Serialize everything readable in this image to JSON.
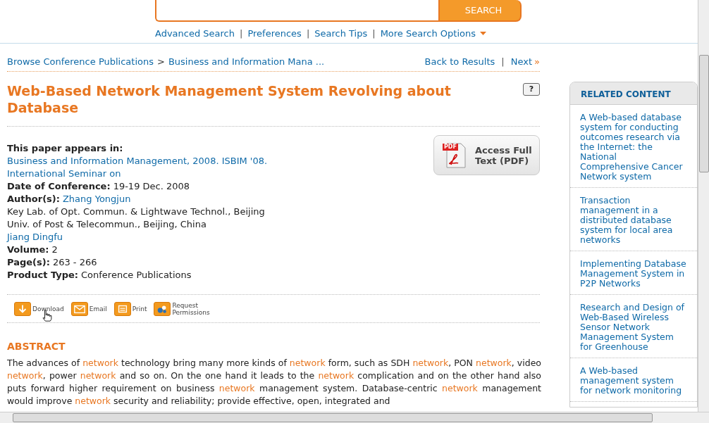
{
  "search": {
    "button": "SEARCH",
    "separator": "|",
    "links": [
      "Advanced Search",
      "Preferences",
      "Search Tips",
      "More Search Options"
    ]
  },
  "breadcrumb": {
    "items": [
      "Browse Conference Publications",
      "Business and Information Mana ..."
    ],
    "separator": ">"
  },
  "result_nav": {
    "back": "Back to Results",
    "next": "Next",
    "next_mark": "»",
    "separator": "|"
  },
  "title": "Web-Based Network Management System Revolving about Database",
  "help_button": "?",
  "pdf_button": {
    "badge": "PDF",
    "label": "Access Full Text (PDF)"
  },
  "metadata": [
    {
      "kind": "heading",
      "label": "This paper appears in:"
    },
    {
      "kind": "link",
      "text": "Business and Information Management, 2008. ISBIM '08. International Seminar on"
    },
    {
      "kind": "field",
      "label": "Date of Conference:",
      "value": "19-19 Dec. 2008"
    },
    {
      "kind": "field_link",
      "label": "Author(s):",
      "value": "Zhang Yongjun"
    },
    {
      "kind": "plain",
      "text": "Key Lab. of Opt. Commun. & Lightwave Technol., Beijing"
    },
    {
      "kind": "plain",
      "text": "Univ. of Post & Telecommun., Beijing, China"
    },
    {
      "kind": "link",
      "text": "Jiang Dingfu"
    },
    {
      "kind": "field",
      "label": "Volume:",
      "value": "2"
    },
    {
      "kind": "field",
      "label": "Page(s):",
      "value": "263 - 266"
    },
    {
      "kind": "field",
      "label": "Product Type:",
      "value": "Conference Publications"
    }
  ],
  "actions": [
    {
      "kind": "download",
      "lines": [
        "Download"
      ]
    },
    {
      "kind": "email",
      "lines": [
        "Email"
      ]
    },
    {
      "kind": "print",
      "lines": [
        "Print"
      ]
    },
    {
      "kind": "permissions",
      "lines": [
        "Request",
        "Permissions"
      ]
    }
  ],
  "abstract": {
    "heading": "ABSTRACT",
    "segments": [
      {
        "text": "The advances of ",
        "highlight": false
      },
      {
        "text": "network",
        "highlight": true
      },
      {
        "text": " technology bring many more kinds of ",
        "highlight": false
      },
      {
        "text": "network",
        "highlight": true
      },
      {
        "text": " form, such as SDH ",
        "highlight": false
      },
      {
        "text": "network",
        "highlight": true
      },
      {
        "text": ", PON ",
        "highlight": false
      },
      {
        "text": "network",
        "highlight": true
      },
      {
        "text": ", video ",
        "highlight": false
      },
      {
        "text": "network",
        "highlight": true
      },
      {
        "text": ", power ",
        "highlight": false
      },
      {
        "text": "network",
        "highlight": true
      },
      {
        "text": " and so on. On the one hand it leads to the ",
        "highlight": false
      },
      {
        "text": "network",
        "highlight": true
      },
      {
        "text": " complication and on the other hand also puts forward higher requirement on business ",
        "highlight": false
      },
      {
        "text": "network",
        "highlight": true
      },
      {
        "text": " management system. Database-centric ",
        "highlight": false
      },
      {
        "text": "network",
        "highlight": true
      },
      {
        "text": " management would improve ",
        "highlight": false
      },
      {
        "text": "network",
        "highlight": true
      },
      {
        "text": " security and reliability; provide effective, open, integrated and",
        "highlight": false
      }
    ]
  },
  "related": {
    "title": "RELATED CONTENT",
    "items": [
      "A Web-based database system for conducting outcomes research via the Internet: the National Comprehensive Cancer Network system",
      "Transaction management in a distributed database system for local area networks",
      "Implementing Database Management System in P2P Networks",
      "Research and Design of Web-Based Wireless Sensor Network Management System for Greenhouse",
      "A Web-based management system for network monitoring"
    ]
  }
}
